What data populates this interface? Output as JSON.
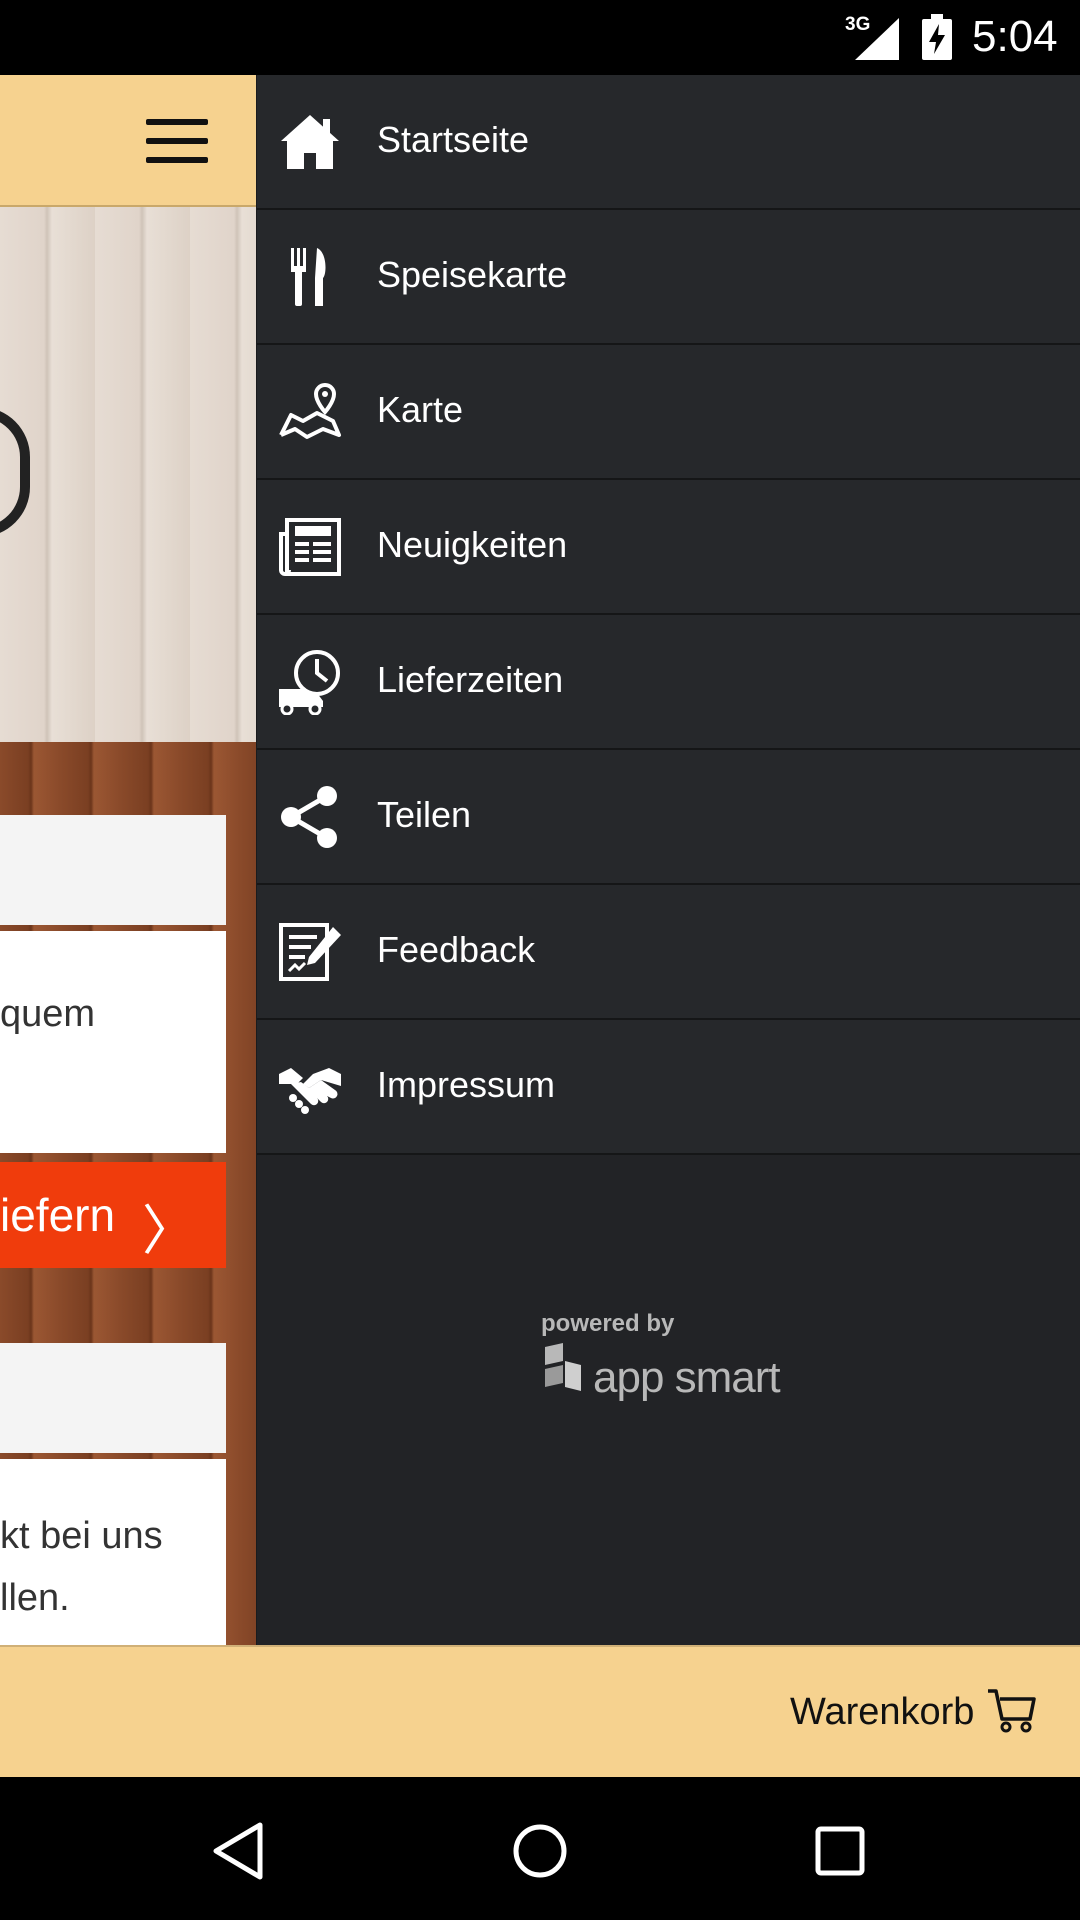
{
  "status_bar": {
    "network": "3G",
    "time": "5:04"
  },
  "background": {
    "card1_text": "quem",
    "order_button_label": "iefern",
    "card2_text_line1": "kt bei uns",
    "card2_text_line2": "llen."
  },
  "drawer": {
    "items": [
      {
        "label": "Startseite",
        "icon": "home-icon"
      },
      {
        "label": "Speisekarte",
        "icon": "fork-knife-icon"
      },
      {
        "label": "Karte",
        "icon": "map-pin-icon"
      },
      {
        "label": "Neuigkeiten",
        "icon": "newspaper-icon"
      },
      {
        "label": "Lieferzeiten",
        "icon": "delivery-clock-icon"
      },
      {
        "label": "Teilen",
        "icon": "share-icon"
      },
      {
        "label": "Feedback",
        "icon": "feedback-icon"
      },
      {
        "label": "Impressum",
        "icon": "handshake-icon"
      }
    ],
    "powered_by": "powered by",
    "brand": "app smart"
  },
  "cart": {
    "label": "Warenkorb"
  },
  "colors": {
    "accent": "#f6d28f",
    "order_button": "#f03c0c",
    "drawer_bg": "#26282b"
  }
}
